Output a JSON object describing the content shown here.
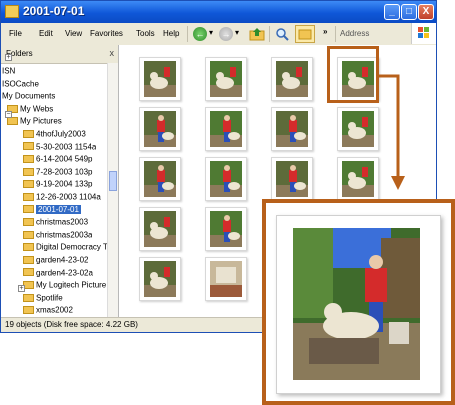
{
  "window": {
    "title": "2001-07-01",
    "controls": {
      "minimize": "_",
      "maximize": "□",
      "close": "X"
    }
  },
  "menu": {
    "items": [
      "File",
      "Edit",
      "View",
      "Favorites",
      "Tools",
      "Help"
    ],
    "more": "»",
    "address_label": "Address"
  },
  "toolbar": {
    "back_arrow": "←",
    "forward_arrow": "→",
    "dropdown": "▾"
  },
  "sidebar": {
    "header": "Folders",
    "close": "x",
    "items": [
      {
        "label": "ISN",
        "indent": 0,
        "icon": false
      },
      {
        "label": "ISOCache",
        "indent": 0,
        "icon": false
      },
      {
        "label": "My Documents",
        "indent": 0,
        "icon": false
      },
      {
        "label": "My Webs",
        "indent": 1,
        "icon": true
      },
      {
        "label": "My Pictures",
        "indent": 1,
        "icon": true
      },
      {
        "label": "4thofJuly2003",
        "indent": 2,
        "icon": true
      },
      {
        "label": "5-30-2003 1154a",
        "indent": 2,
        "icon": true
      },
      {
        "label": "6-14-2004 549p",
        "indent": 2,
        "icon": true
      },
      {
        "label": "7-28-2003 103p",
        "indent": 2,
        "icon": true
      },
      {
        "label": "9-19-2004 133p",
        "indent": 2,
        "icon": true
      },
      {
        "label": "12-26-2003 1104a",
        "indent": 2,
        "icon": true
      },
      {
        "label": "2001-07-01",
        "indent": 2,
        "icon": true,
        "selected": true
      },
      {
        "label": "christmas2003",
        "indent": 2,
        "icon": true
      },
      {
        "label": "christmas2003a",
        "indent": 2,
        "icon": true
      },
      {
        "label": "Digital Democracy T",
        "indent": 2,
        "icon": true
      },
      {
        "label": "garden4-23-02",
        "indent": 2,
        "icon": true
      },
      {
        "label": "garden4-23-02a",
        "indent": 2,
        "icon": true
      },
      {
        "label": "My Logitech Picture",
        "indent": 2,
        "icon": true
      },
      {
        "label": "Spotlife",
        "indent": 2,
        "icon": true
      },
      {
        "label": "xmas2002",
        "indent": 2,
        "icon": true
      }
    ]
  },
  "thumbnails": [
    {
      "scene": "dog"
    },
    {
      "scene": "dog"
    },
    {
      "scene": "dog"
    },
    {
      "scene": "dog"
    },
    {
      "scene": "person"
    },
    {
      "scene": "person"
    },
    {
      "scene": "person"
    },
    {
      "scene": "dog"
    },
    {
      "scene": "person"
    },
    {
      "scene": "person"
    },
    {
      "scene": "person"
    },
    {
      "scene": "dog"
    },
    {
      "scene": "dog"
    },
    {
      "scene": "person"
    },
    {
      "scene": "person"
    },
    {
      "scene": "person"
    },
    {
      "scene": "dog"
    },
    {
      "scene": "room"
    }
  ],
  "status": {
    "text": "19 objects (Disk free space: 4.22 GB)"
  },
  "colors": {
    "highlight": "#b8601a",
    "selection": "#316ac5",
    "titlebar": "#0f57d8"
  }
}
